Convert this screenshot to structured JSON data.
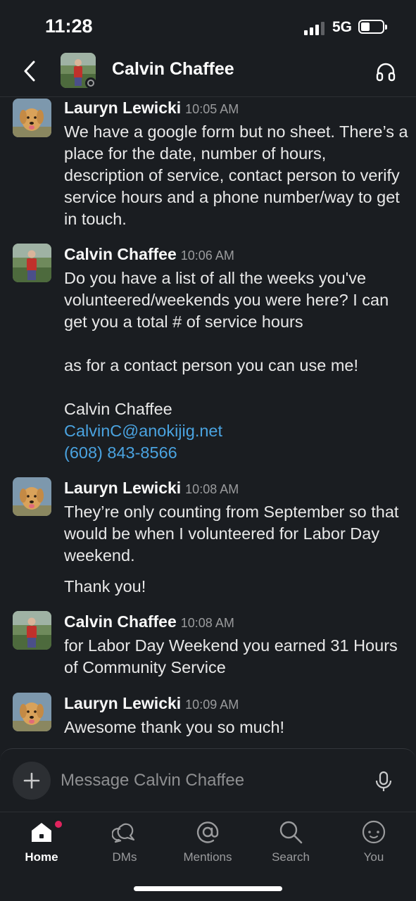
{
  "status_bar": {
    "time": "11:28",
    "network": "5G"
  },
  "header": {
    "title": "Calvin Chaffee"
  },
  "messages": [
    {
      "author": "Lauryn Lewicki",
      "time": "10:05 AM",
      "avatar": "golden-retriever",
      "paragraphs": [
        "We have a google form but no sheet. There’s a place for the date, number of hours, description of service, contact person to verify service hours and a phone number/way to get in touch."
      ]
    },
    {
      "author": "Calvin Chaffee",
      "time": "10:06 AM",
      "avatar": "person-outdoors",
      "paragraphs": [
        "Do you have a list of all the weeks you've volunteered/weekends you were here? I can get you a total # of service hours",
        "as for a contact person you can use me!"
      ],
      "signature": {
        "name": "Calvin Chaffee",
        "email": "CalvinC@anokijig.net",
        "phone": "(608) 843-8566"
      }
    },
    {
      "author": "Lauryn Lewicki",
      "time": "10:08 AM",
      "avatar": "golden-retriever",
      "paragraphs": [
        "They’re only counting from September so that would be when I volunteered for Labor Day weekend.",
        "Thank you!"
      ]
    },
    {
      "author": "Calvin Chaffee",
      "time": "10:08 AM",
      "avatar": "person-outdoors",
      "paragraphs": [
        "for Labor Day Weekend you earned 31 Hours of Community Service"
      ]
    },
    {
      "author": "Lauryn Lewicki",
      "time": "10:09 AM",
      "avatar": "golden-retriever",
      "paragraphs": [
        "Awesome thank you so much!"
      ]
    }
  ],
  "composer": {
    "placeholder": "Message Calvin Chaffee",
    "value": ""
  },
  "tabs": [
    {
      "label": "Home",
      "icon": "home-icon",
      "active": true
    },
    {
      "label": "DMs",
      "icon": "dms-icon",
      "active": false
    },
    {
      "label": "Mentions",
      "icon": "mentions-icon",
      "active": false
    },
    {
      "label": "Search",
      "icon": "search-icon",
      "active": false
    },
    {
      "label": "You",
      "icon": "you-icon",
      "active": false
    }
  ],
  "colors": {
    "background": "#1a1d21",
    "link": "#4aa3e0",
    "notification": "#e0245e"
  }
}
